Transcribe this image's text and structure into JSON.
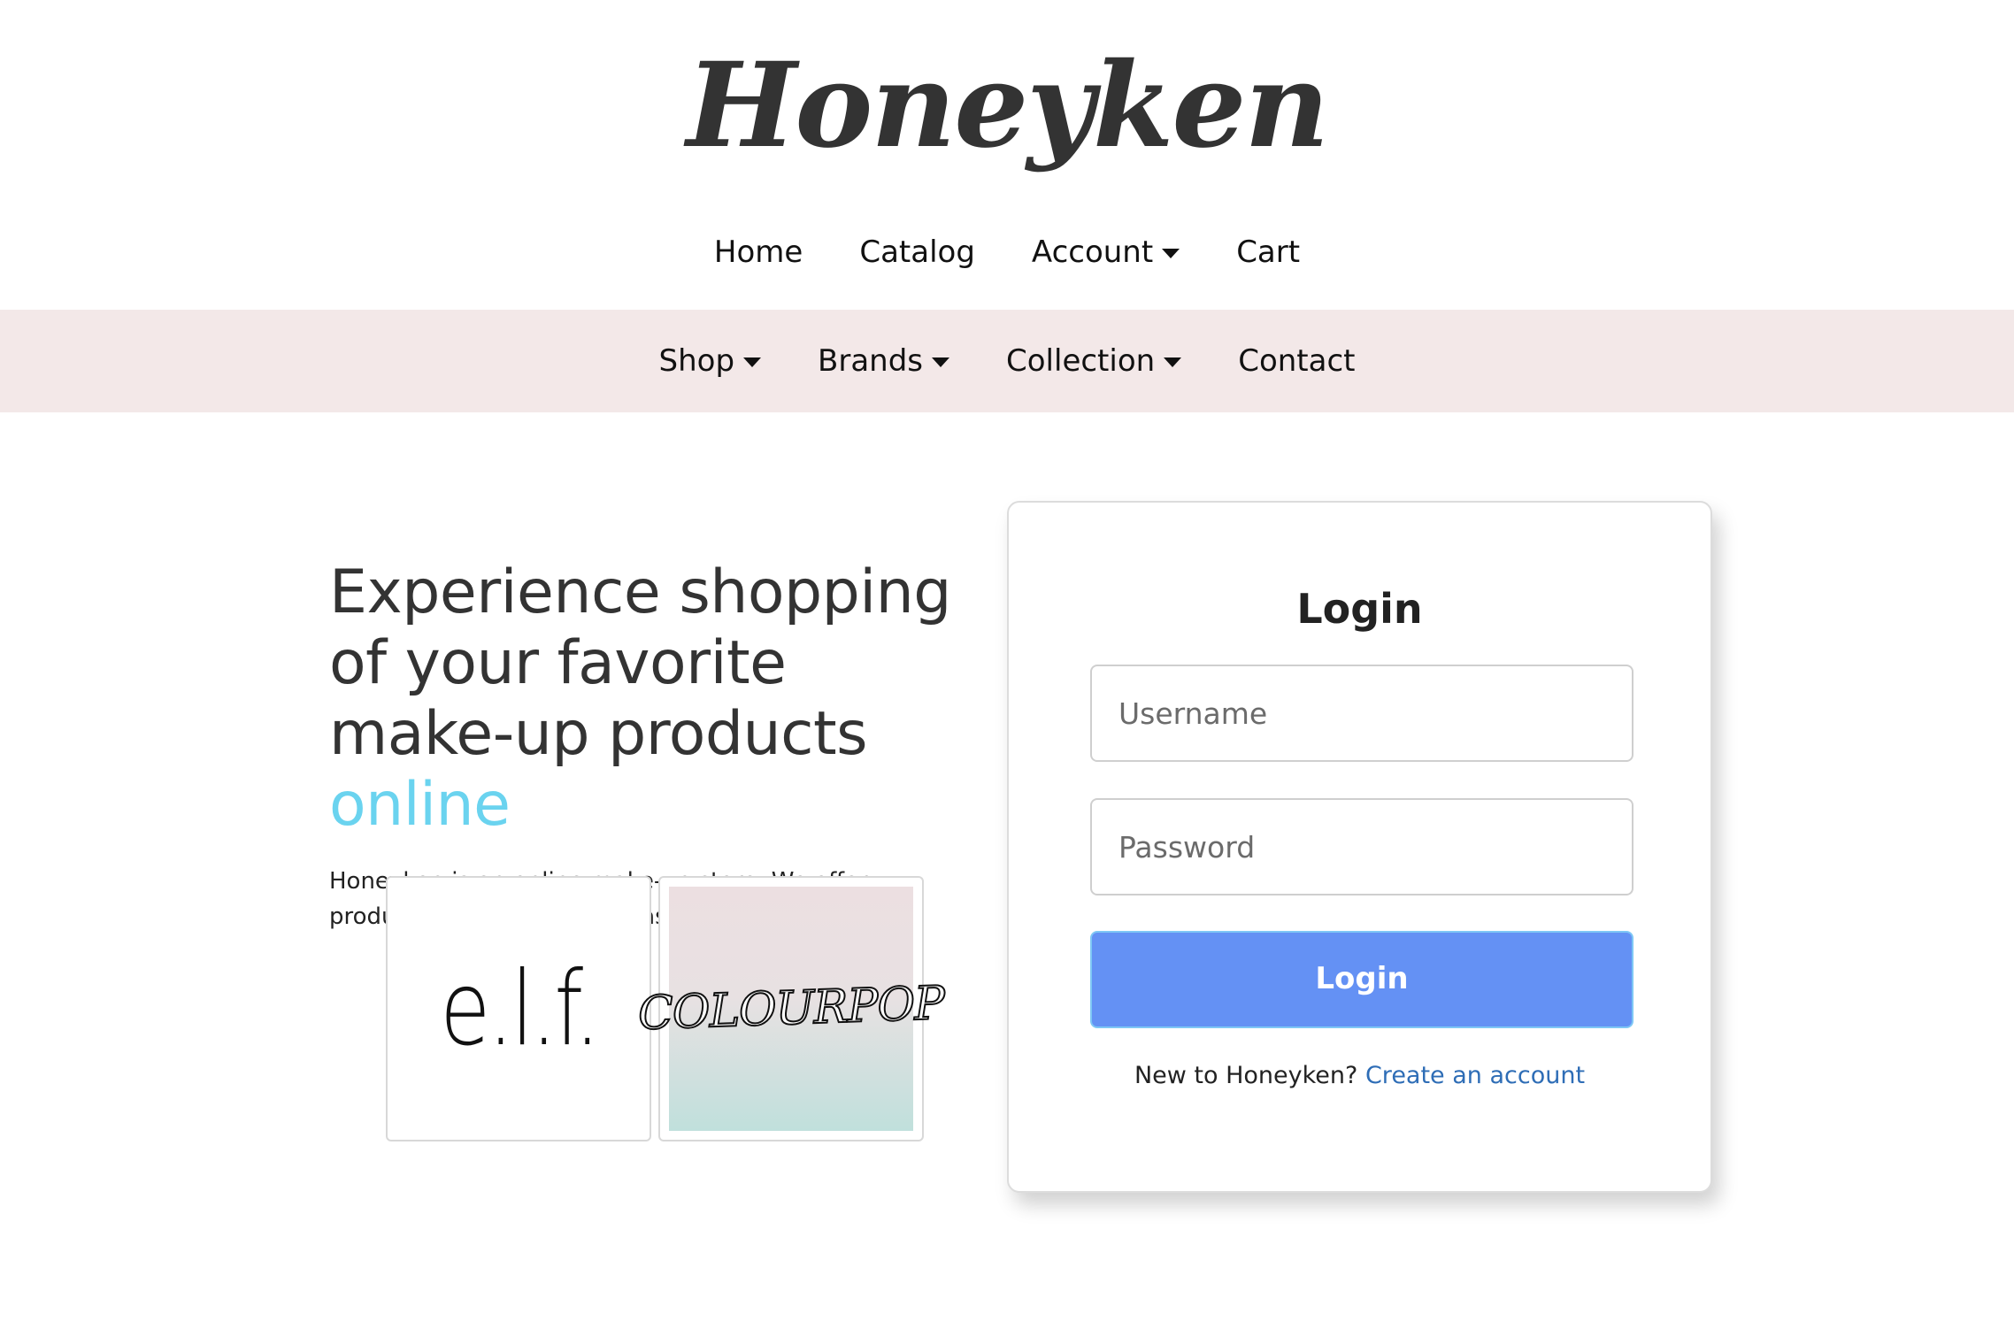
{
  "brand": {
    "logo_text": "Honeyken"
  },
  "top_nav": {
    "items": [
      {
        "label": "Home",
        "has_dropdown": false
      },
      {
        "label": "Catalog",
        "has_dropdown": false
      },
      {
        "label": "Account",
        "has_dropdown": true
      },
      {
        "label": "Cart",
        "has_dropdown": false
      }
    ]
  },
  "category_nav": {
    "background_color": "#f3e8e8",
    "items": [
      {
        "label": "Shop",
        "has_dropdown": true
      },
      {
        "label": "Brands",
        "has_dropdown": true
      },
      {
        "label": "Collection",
        "has_dropdown": true
      },
      {
        "label": "Contact",
        "has_dropdown": false
      }
    ]
  },
  "hero": {
    "title_main": "Experience shopping of your favorite make-up products ",
    "title_accent": "online",
    "accent_color": "#6ad3ef",
    "description": "Honeyken is an online make-up store. We offer products with brands such as:"
  },
  "brands": [
    {
      "name": "e.l.f.",
      "logo_text": "e.l.f."
    },
    {
      "name": "ColourPop",
      "logo_text": "COLOURPOP"
    }
  ],
  "login": {
    "title": "Login",
    "username_placeholder": "Username",
    "password_placeholder": "Password",
    "submit_label": "Login",
    "button_color": "#6491f4",
    "signup_prompt": "New to Honeyken?",
    "signup_link": "Create an account",
    "link_color": "#2e6db6"
  }
}
